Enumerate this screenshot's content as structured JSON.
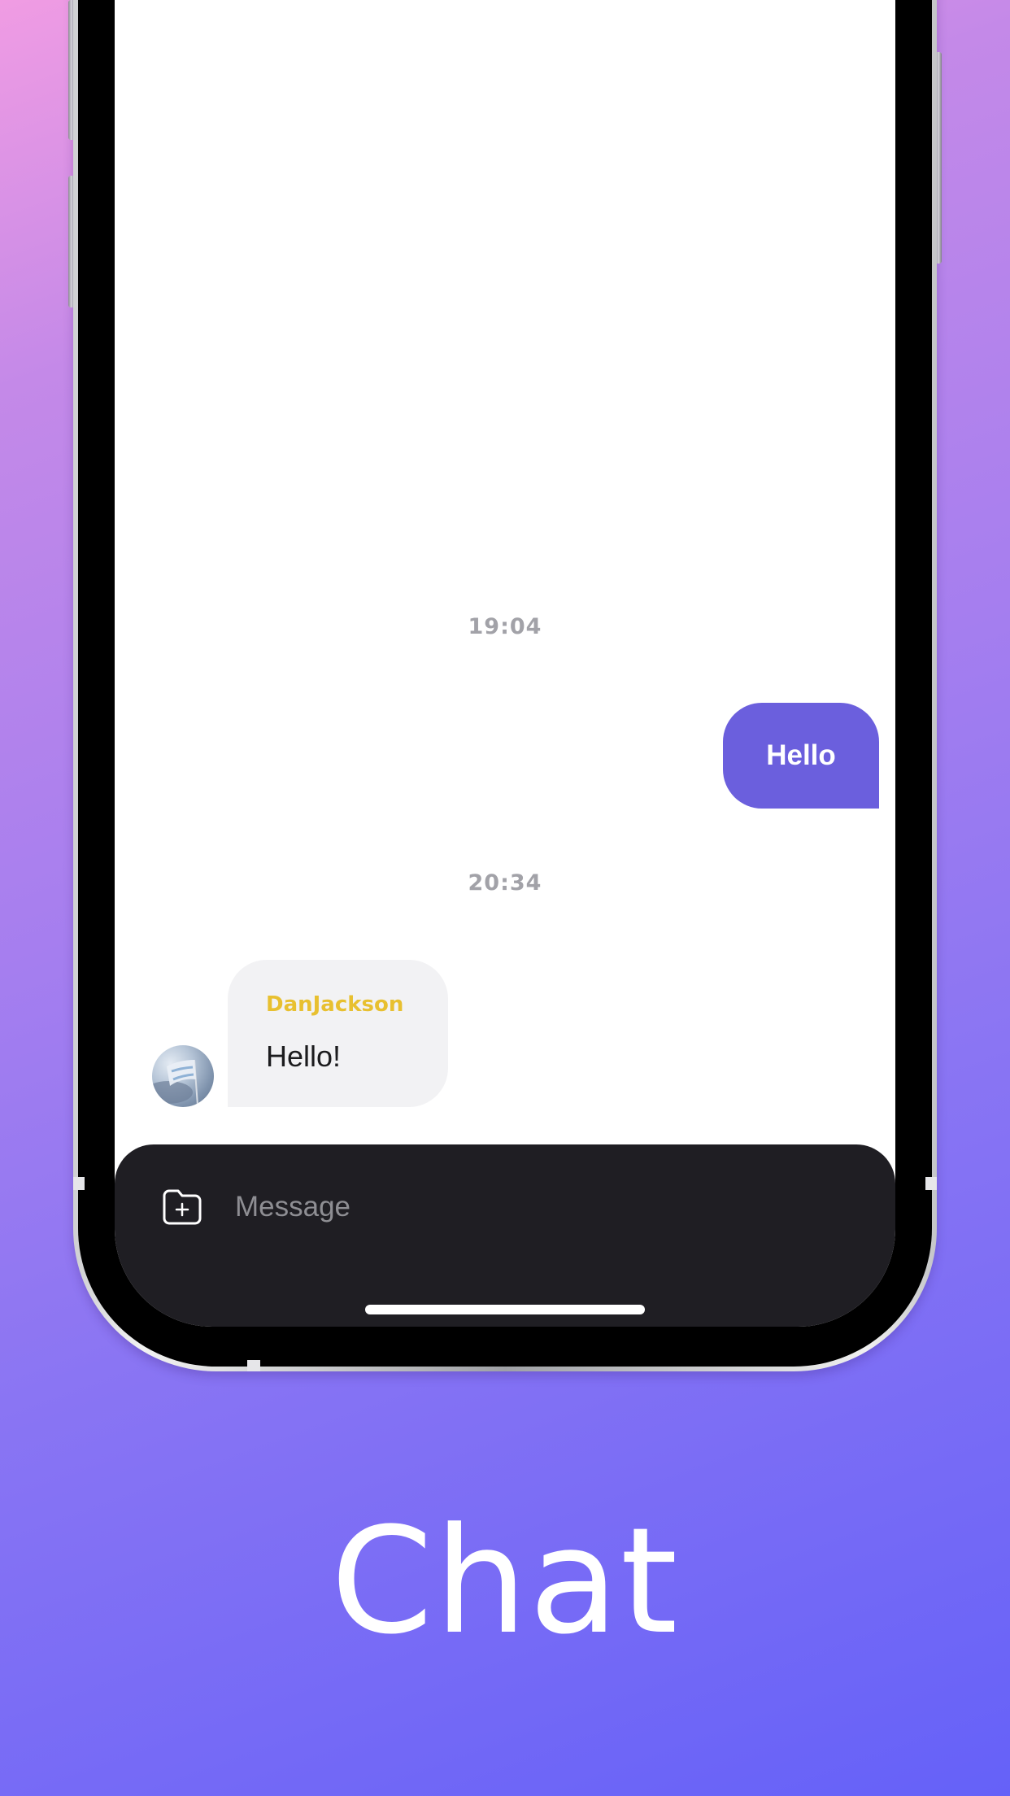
{
  "chat": {
    "timestamps": [
      "19:04",
      "20:34"
    ],
    "messages": [
      {
        "direction": "outgoing",
        "text": "Hello"
      },
      {
        "direction": "incoming",
        "sender": "DanJackson",
        "text": "Hello!"
      }
    ]
  },
  "composer": {
    "placeholder": "Message",
    "attach_icon": "folder-plus-icon"
  },
  "caption": "Chat",
  "colors": {
    "outgoing_bubble": "#6b5fdd",
    "incoming_bubble": "#f2f2f4",
    "sender_name": "#e8c030",
    "composer_bg": "#1f1e23",
    "timestamp": "#a2a2a8"
  }
}
